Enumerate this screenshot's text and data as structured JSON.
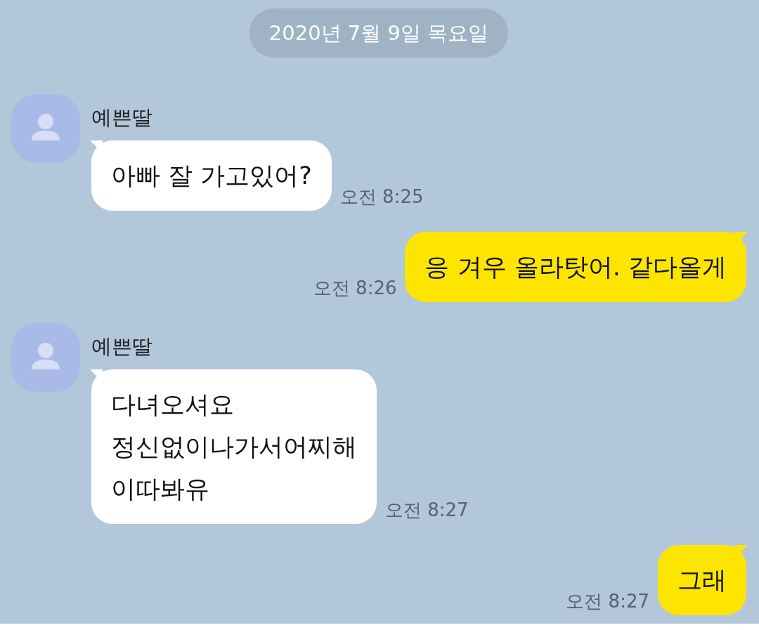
{
  "date_divider": "2020년 7월 9일 목요일",
  "messages": [
    {
      "kind": "received",
      "sender": "예쁜딸",
      "text": "아빠 잘 가고있어?",
      "time": "오전 8:25"
    },
    {
      "kind": "sent",
      "text": "응 겨우 올라탓어. 같다올게",
      "time": "오전 8:26"
    },
    {
      "kind": "received",
      "sender": "예쁜딸",
      "text": "다녀오셔요\n정신없이나가서어찌해\n이따봐유",
      "time": "오전 8:27"
    },
    {
      "kind": "sent",
      "text": "그래",
      "time": "오전 8:27"
    }
  ]
}
